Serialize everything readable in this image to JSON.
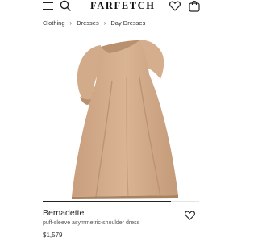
{
  "header": {
    "logo": "FARFETCH",
    "icons": [
      "menu-icon",
      "search-icon",
      "heart-icon",
      "shopping-bag-icon"
    ]
  },
  "breadcrumb": {
    "items": [
      "Clothing",
      "Dresses",
      "Day Dresses"
    ],
    "separator": "›"
  },
  "gallery": {
    "progress": 0.82
  },
  "product": {
    "brand": "Bernadette",
    "description": "puff-sleeve asymmetric-shoulder dress",
    "price": "$1,579"
  },
  "colors": {
    "dress": "#d4ad8c",
    "dress_shadow": "#b78f6f",
    "text": "#222222",
    "muted": "#555555"
  }
}
